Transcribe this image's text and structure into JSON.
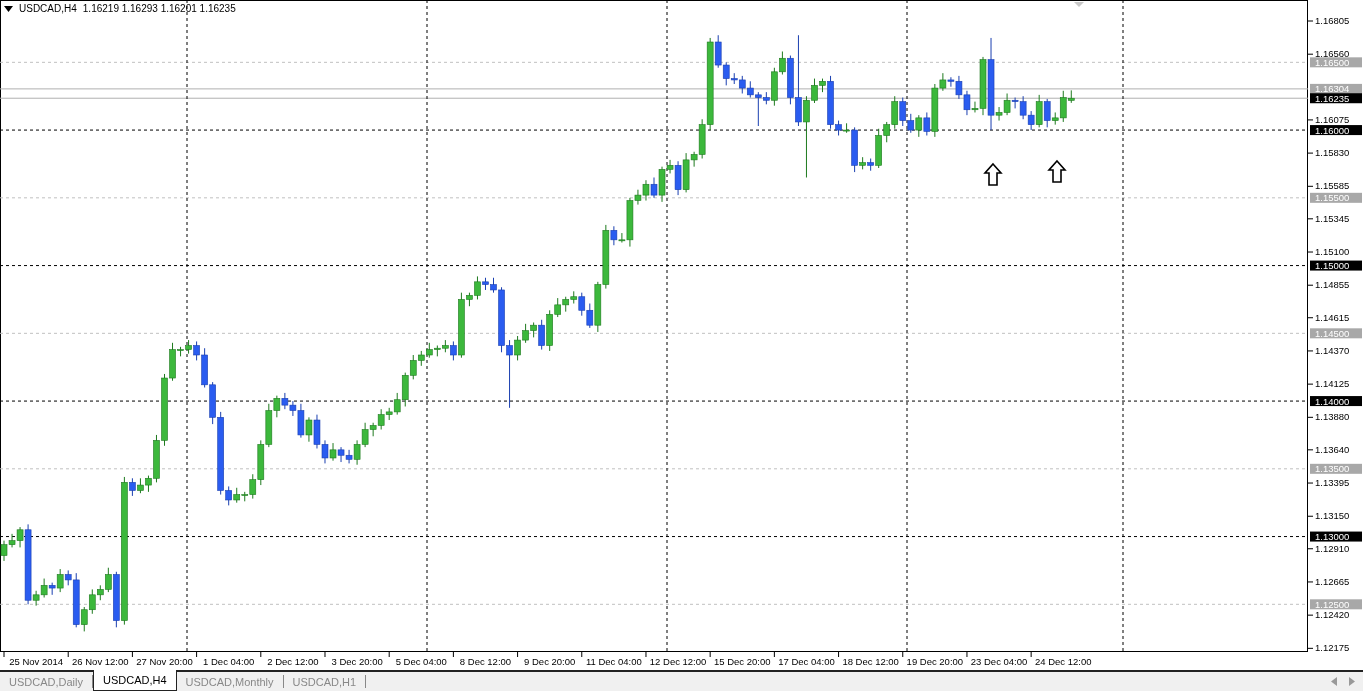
{
  "header": {
    "quote": "1.16219 1.16293 1.16201 1.16235"
  },
  "chart": {
    "chart_data": {
      "type": "candlestick",
      "title": "USDCAD,H4",
      "ylim": [
        1.12148,
        1.1696
      ],
      "categories": [
        null,
        null,
        null,
        null,
        "25 Nov 2014",
        null,
        null,
        null,
        null,
        null,
        null,
        null,
        "26 Nov 12:00",
        null,
        null,
        null,
        null,
        null,
        null,
        null,
        "27 Nov 20:00",
        null,
        null,
        null,
        null,
        null,
        null,
        null,
        "1 Dec 04:00",
        null,
        null,
        null,
        null,
        null,
        null,
        null,
        "2 Dec 12:00",
        null,
        null,
        null,
        null,
        null,
        null,
        null,
        "3 Dec 20:00",
        null,
        null,
        null,
        null,
        null,
        null,
        null,
        "5 Dec 04:00",
        null,
        null,
        null,
        null,
        null,
        null,
        null,
        "8 Dec 12:00",
        null,
        null,
        null,
        null,
        null,
        null,
        null,
        "9 Dec 20:00",
        null,
        null,
        null,
        null,
        null,
        null,
        null,
        "11 Dec 04:00",
        null,
        null,
        null,
        null,
        null,
        null,
        null,
        "12 Dec 12:00",
        null,
        null,
        null,
        null,
        null,
        null,
        null,
        "15 Dec 20:00",
        null,
        null,
        null,
        null,
        null,
        null,
        null,
        "17 Dec 04:00",
        null,
        null,
        null,
        null,
        null,
        null,
        null,
        "18 Dec 12:00",
        null,
        null,
        null,
        null,
        null,
        null,
        null,
        "19 Dec 20:00",
        null,
        null,
        null,
        null,
        null,
        null,
        null,
        "23 Dec 04:00",
        null,
        null,
        null,
        null,
        null,
        null,
        null,
        "24 Dec 12:00",
        null,
        null,
        null,
        null,
        null,
        null,
        null,
        null,
        null,
        null,
        null,
        null,
        null,
        null,
        null,
        null,
        null,
        null,
        null,
        null,
        null,
        null,
        null,
        null,
        null,
        null,
        null,
        null,
        null,
        null
      ],
      "ohlc": [
        [
          1.1286,
          1.1297,
          1.1282,
          1.1294
        ],
        [
          1.1294,
          1.1302,
          1.1292,
          1.1297
        ],
        [
          1.1297,
          1.1307,
          1.1292,
          1.1305
        ],
        [
          1.1305,
          1.1309,
          1.125,
          1.1253
        ],
        [
          1.1253,
          1.126,
          1.1249,
          1.1257
        ],
        [
          1.1257,
          1.1269,
          1.1255,
          1.1264
        ],
        [
          1.1264,
          1.1266,
          1.1257,
          1.1262
        ],
        [
          1.1262,
          1.1276,
          1.1259,
          1.1272
        ],
        [
          1.1272,
          1.1275,
          1.1264,
          1.1268
        ],
        [
          1.1268,
          1.1273,
          1.1233,
          1.1235
        ],
        [
          1.1235,
          1.1248,
          1.123,
          1.1246
        ],
        [
          1.1246,
          1.1261,
          1.1243,
          1.1257
        ],
        [
          1.1257,
          1.1264,
          1.1253,
          1.1261
        ],
        [
          1.1261,
          1.1277,
          1.1259,
          1.1272
        ],
        [
          1.1272,
          1.1274,
          1.1233,
          1.1238
        ],
        [
          1.1238,
          1.1344,
          1.1235,
          1.134
        ],
        [
          1.134,
          1.1343,
          1.133,
          1.1334
        ],
        [
          1.1334,
          1.1343,
          1.1332,
          1.1338
        ],
        [
          1.1338,
          1.1345,
          1.1333,
          1.1343
        ],
        [
          1.1343,
          1.1375,
          1.134,
          1.1371
        ],
        [
          1.1371,
          1.142,
          1.1367,
          1.1417
        ],
        [
          1.1417,
          1.1443,
          1.1415,
          1.1438
        ],
        [
          1.1438,
          1.144,
          1.1433,
          1.1438
        ],
        [
          1.1438,
          1.1445,
          1.1435,
          1.1441
        ],
        [
          1.1441,
          1.1444,
          1.143,
          1.1434
        ],
        [
          1.1434,
          1.1439,
          1.141,
          1.1412
        ],
        [
          1.1412,
          1.1414,
          1.1383,
          1.1388
        ],
        [
          1.1388,
          1.1392,
          1.1331,
          1.1334
        ],
        [
          1.1334,
          1.1337,
          1.1323,
          1.1327
        ],
        [
          1.1327,
          1.1336,
          1.1325,
          1.1331
        ],
        [
          1.1331,
          1.1333,
          1.1326,
          1.1331
        ],
        [
          1.1331,
          1.1346,
          1.1328,
          1.1342
        ],
        [
          1.1342,
          1.1371,
          1.1338,
          1.1368
        ],
        [
          1.1368,
          1.1398,
          1.1366,
          1.1393
        ],
        [
          1.1393,
          1.1404,
          1.1388,
          1.1402
        ],
        [
          1.1402,
          1.1406,
          1.1394,
          1.1397
        ],
        [
          1.1397,
          1.14,
          1.1389,
          1.1393
        ],
        [
          1.1393,
          1.1398,
          1.1373,
          1.1375
        ],
        [
          1.1375,
          1.1388,
          1.137,
          1.1386
        ],
        [
          1.1386,
          1.139,
          1.1365,
          1.1368
        ],
        [
          1.1368,
          1.1371,
          1.1354,
          1.1358
        ],
        [
          1.1358,
          1.1369,
          1.1356,
          1.1364
        ],
        [
          1.1364,
          1.1366,
          1.1355,
          1.136
        ],
        [
          1.136,
          1.1364,
          1.1354,
          1.1357
        ],
        [
          1.1357,
          1.1371,
          1.1353,
          1.1368
        ],
        [
          1.1368,
          1.1384,
          1.1366,
          1.1379
        ],
        [
          1.1379,
          1.1384,
          1.1374,
          1.1382
        ],
        [
          1.1382,
          1.1394,
          1.1379,
          1.139
        ],
        [
          1.139,
          1.1395,
          1.1386,
          1.1392
        ],
        [
          1.1392,
          1.1406,
          1.139,
          1.1401
        ],
        [
          1.1401,
          1.1421,
          1.1396,
          1.1419
        ],
        [
          1.1419,
          1.1434,
          1.1416,
          1.143
        ],
        [
          1.143,
          1.1437,
          1.1426,
          1.1434
        ],
        [
          1.1434,
          1.1443,
          1.1432,
          1.1438
        ],
        [
          1.1438,
          1.1441,
          1.1433,
          1.1439
        ],
        [
          1.1439,
          1.1445,
          1.1436,
          1.1441
        ],
        [
          1.1441,
          1.1444,
          1.143,
          1.1434
        ],
        [
          1.1434,
          1.148,
          1.1432,
          1.1475
        ],
        [
          1.1475,
          1.148,
          1.147,
          1.1478
        ],
        [
          1.1478,
          1.1492,
          1.1475,
          1.1488
        ],
        [
          1.1488,
          1.1491,
          1.1482,
          1.1486
        ],
        [
          1.1486,
          1.1491,
          1.148,
          1.1482
        ],
        [
          1.1482,
          1.1484,
          1.1436,
          1.1441
        ],
        [
          1.1441,
          1.1445,
          1.1395,
          1.1434
        ],
        [
          1.1434,
          1.1448,
          1.143,
          1.1445
        ],
        [
          1.1445,
          1.1457,
          1.1443,
          1.1452
        ],
        [
          1.1452,
          1.1458,
          1.1447,
          1.1456
        ],
        [
          1.1456,
          1.146,
          1.1438,
          1.1441
        ],
        [
          1.1441,
          1.1467,
          1.1437,
          1.1464
        ],
        [
          1.1464,
          1.1476,
          1.1462,
          1.1471
        ],
        [
          1.1471,
          1.1477,
          1.1466,
          1.1475
        ],
        [
          1.1475,
          1.1481,
          1.1472,
          1.1477
        ],
        [
          1.1477,
          1.148,
          1.1463,
          1.1467
        ],
        [
          1.1467,
          1.1472,
          1.1454,
          1.1456
        ],
        [
          1.1456,
          1.1488,
          1.1451,
          1.1486
        ],
        [
          1.1486,
          1.153,
          1.1483,
          1.1526
        ],
        [
          1.1526,
          1.1529,
          1.1515,
          1.1519
        ],
        [
          1.1519,
          1.1524,
          1.1517,
          1.1519
        ],
        [
          1.1519,
          1.155,
          1.1514,
          1.1548
        ],
        [
          1.1548,
          1.1556,
          1.1545,
          1.1552
        ],
        [
          1.1552,
          1.1563,
          1.1548,
          1.156
        ],
        [
          1.156,
          1.1565,
          1.155,
          1.1552
        ],
        [
          1.1552,
          1.1573,
          1.1547,
          1.1571
        ],
        [
          1.1571,
          1.1578,
          1.1568,
          1.1574
        ],
        [
          1.1574,
          1.1577,
          1.1552,
          1.1556
        ],
        [
          1.1556,
          1.1583,
          1.1554,
          1.1578
        ],
        [
          1.1578,
          1.1584,
          1.1573,
          1.1582
        ],
        [
          1.1582,
          1.1608,
          1.1579,
          1.1604
        ],
        [
          1.1604,
          1.1668,
          1.16,
          1.1665
        ],
        [
          1.1665,
          1.167,
          1.1646,
          1.1648
        ],
        [
          1.1648,
          1.165,
          1.1633,
          1.1638
        ],
        [
          1.1638,
          1.1642,
          1.1634,
          1.1637
        ],
        [
          1.1637,
          1.164,
          1.1627,
          1.1631
        ],
        [
          1.1631,
          1.1636,
          1.1624,
          1.1626
        ],
        [
          1.1626,
          1.1628,
          1.1603,
          1.1624
        ],
        [
          1.1624,
          1.1628,
          1.1619,
          1.1622
        ],
        [
          1.1622,
          1.1646,
          1.1618,
          1.1643
        ],
        [
          1.1643,
          1.1658,
          1.1641,
          1.1653
        ],
        [
          1.1653,
          1.1655,
          1.1619,
          1.1624
        ],
        [
          1.1624,
          1.167,
          1.1603,
          1.1606
        ],
        [
          1.1606,
          1.1625,
          1.1565,
          1.1622
        ],
        [
          1.1622,
          1.1638,
          1.162,
          1.1633
        ],
        [
          1.1633,
          1.1638,
          1.1628,
          1.1636
        ],
        [
          1.1636,
          1.164,
          1.1601,
          1.1604
        ],
        [
          1.1604,
          1.1607,
          1.1596,
          1.16
        ],
        [
          1.16,
          1.1605,
          1.1598,
          1.16
        ],
        [
          1.16,
          1.1602,
          1.1569,
          1.1574
        ],
        [
          1.1574,
          1.158,
          1.1571,
          1.1576
        ],
        [
          1.1576,
          1.1579,
          1.157,
          1.1574
        ],
        [
          1.1574,
          1.1601,
          1.1572,
          1.1596
        ],
        [
          1.1596,
          1.1606,
          1.1591,
          1.1604
        ],
        [
          1.1604,
          1.1625,
          1.1601,
          1.1621
        ],
        [
          1.1621,
          1.1624,
          1.1603,
          1.1607
        ],
        [
          1.1607,
          1.1612,
          1.1598,
          1.16
        ],
        [
          1.16,
          1.1611,
          1.1595,
          1.1609
        ],
        [
          1.1609,
          1.1613,
          1.1596,
          1.1599
        ],
        [
          1.1599,
          1.1634,
          1.1595,
          1.1631
        ],
        [
          1.1631,
          1.1642,
          1.1629,
          1.1637
        ],
        [
          1.1637,
          1.1639,
          1.1632,
          1.1636
        ],
        [
          1.1636,
          1.164,
          1.1623,
          1.1626
        ],
        [
          1.1626,
          1.1629,
          1.1611,
          1.1615
        ],
        [
          1.1615,
          1.1621,
          1.1613,
          1.1616
        ],
        [
          1.1616,
          1.1654,
          1.1611,
          1.1652
        ],
        [
          1.1652,
          1.1668,
          1.16,
          1.1611
        ],
        [
          1.1611,
          1.1617,
          1.1607,
          1.1613
        ],
        [
          1.1613,
          1.1627,
          1.1611,
          1.1622
        ],
        [
          1.1622,
          1.1624,
          1.1616,
          1.1621
        ],
        [
          1.1621,
          1.1625,
          1.1608,
          1.1611
        ],
        [
          1.1611,
          1.1614,
          1.16,
          1.1604
        ],
        [
          1.1604,
          1.1626,
          1.1602,
          1.1621
        ],
        [
          1.1621,
          1.1623,
          1.1602,
          1.1607
        ],
        [
          1.1607,
          1.1613,
          1.1604,
          1.1609
        ],
        [
          1.1609,
          1.1629,
          1.1606,
          1.1624
        ],
        [
          1.16219,
          1.16293,
          1.16201,
          1.16235
        ],
        null,
        null,
        null,
        null,
        null,
        null,
        null,
        null,
        null,
        null,
        null,
        null,
        null,
        null,
        null,
        null,
        null,
        null,
        null,
        null,
        null,
        null,
        null,
        null,
        null,
        null,
        null,
        null,
        null
      ],
      "yticks": [
        {
          "value": 1.16805,
          "label": "1.16805"
        },
        {
          "value": 1.1656,
          "label": "1.16560"
        },
        {
          "value": 1.16075,
          "label": "1.16075"
        },
        {
          "value": 1.1583,
          "label": "1.15830"
        },
        {
          "value": 1.15585,
          "label": "1.15585"
        },
        {
          "value": 1.15345,
          "label": "1.15345"
        },
        {
          "value": 1.151,
          "label": "1.15100"
        },
        {
          "value": 1.14855,
          "label": "1.14855"
        },
        {
          "value": 1.14615,
          "label": "1.14615"
        },
        {
          "value": 1.1437,
          "label": "1.14370"
        },
        {
          "value": 1.14125,
          "label": "1.14125"
        },
        {
          "value": 1.1388,
          "label": "1.13880"
        },
        {
          "value": 1.1364,
          "label": "1.13640"
        },
        {
          "value": 1.13395,
          "label": "1.13395"
        },
        {
          "value": 1.1315,
          "label": "1.13150"
        },
        {
          "value": 1.1291,
          "label": "1.12910"
        },
        {
          "value": 1.12665,
          "label": "1.12665"
        },
        {
          "value": 1.1242,
          "label": "1.12420"
        },
        {
          "value": 1.12175,
          "label": "1.12175"
        }
      ],
      "ref_lines": [
        {
          "axis": "y",
          "value": 1.165,
          "label": "1.16500",
          "color": "#c0c0c0"
        },
        {
          "axis": "y",
          "value": 1.16304,
          "color": "#b0b0b0"
        },
        {
          "axis": "y",
          "value": 1.16235,
          "color": "#b0b0b0"
        },
        {
          "axis": "y",
          "value": 1.16,
          "label": "1.16000",
          "color": "#000000"
        },
        {
          "axis": "y",
          "value": 1.155,
          "label": "1.15500",
          "color": "#c0c0c0"
        },
        {
          "axis": "y",
          "value": 1.15,
          "label": "1.15000",
          "color": "#000000"
        },
        {
          "axis": "y",
          "value": 1.145,
          "label": "1.14500",
          "color": "#c0c0c0"
        },
        {
          "axis": "y",
          "value": 1.14,
          "label": "1.14000",
          "color": "#000000"
        },
        {
          "axis": "y",
          "value": 1.135,
          "label": "1.13500",
          "color": "#c0c0c0"
        },
        {
          "axis": "y",
          "value": 1.13,
          "label": "1.13000",
          "color": "#000000"
        },
        {
          "axis": "y",
          "value": 1.125,
          "label": "1.12500",
          "color": "#c0c0c0"
        }
      ],
      "annotations": [
        "1.16304",
        "1.16235"
      ]
    },
    "markers": [
      {
        "kind": "up_arrow"
      },
      {
        "kind": "up_arrow"
      }
    ]
  },
  "tabs": [
    {
      "label": "USDCAD,Daily",
      "selected": false
    },
    {
      "label": "USDCAD,H4",
      "selected": true
    },
    {
      "label": "USDCAD,Monthly",
      "selected": false
    },
    {
      "label": "USDCAD,H1",
      "selected": false
    }
  ]
}
